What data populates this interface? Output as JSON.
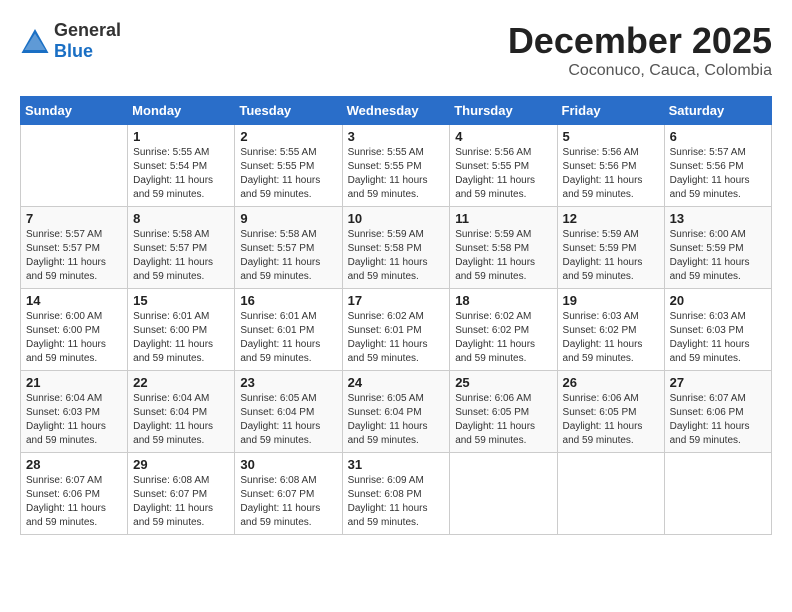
{
  "logo": {
    "general": "General",
    "blue": "Blue"
  },
  "title": "December 2025",
  "location": "Coconuco, Cauca, Colombia",
  "weekdays": [
    "Sunday",
    "Monday",
    "Tuesday",
    "Wednesday",
    "Thursday",
    "Friday",
    "Saturday"
  ],
  "weeks": [
    [
      {
        "day": "",
        "info": ""
      },
      {
        "day": "1",
        "info": "Sunrise: 5:55 AM\nSunset: 5:54 PM\nDaylight: 11 hours\nand 59 minutes."
      },
      {
        "day": "2",
        "info": "Sunrise: 5:55 AM\nSunset: 5:55 PM\nDaylight: 11 hours\nand 59 minutes."
      },
      {
        "day": "3",
        "info": "Sunrise: 5:55 AM\nSunset: 5:55 PM\nDaylight: 11 hours\nand 59 minutes."
      },
      {
        "day": "4",
        "info": "Sunrise: 5:56 AM\nSunset: 5:55 PM\nDaylight: 11 hours\nand 59 minutes."
      },
      {
        "day": "5",
        "info": "Sunrise: 5:56 AM\nSunset: 5:56 PM\nDaylight: 11 hours\nand 59 minutes."
      },
      {
        "day": "6",
        "info": "Sunrise: 5:57 AM\nSunset: 5:56 PM\nDaylight: 11 hours\nand 59 minutes."
      }
    ],
    [
      {
        "day": "7",
        "info": "Sunrise: 5:57 AM\nSunset: 5:57 PM\nDaylight: 11 hours\nand 59 minutes."
      },
      {
        "day": "8",
        "info": "Sunrise: 5:58 AM\nSunset: 5:57 PM\nDaylight: 11 hours\nand 59 minutes."
      },
      {
        "day": "9",
        "info": "Sunrise: 5:58 AM\nSunset: 5:57 PM\nDaylight: 11 hours\nand 59 minutes."
      },
      {
        "day": "10",
        "info": "Sunrise: 5:59 AM\nSunset: 5:58 PM\nDaylight: 11 hours\nand 59 minutes."
      },
      {
        "day": "11",
        "info": "Sunrise: 5:59 AM\nSunset: 5:58 PM\nDaylight: 11 hours\nand 59 minutes."
      },
      {
        "day": "12",
        "info": "Sunrise: 5:59 AM\nSunset: 5:59 PM\nDaylight: 11 hours\nand 59 minutes."
      },
      {
        "day": "13",
        "info": "Sunrise: 6:00 AM\nSunset: 5:59 PM\nDaylight: 11 hours\nand 59 minutes."
      }
    ],
    [
      {
        "day": "14",
        "info": "Sunrise: 6:00 AM\nSunset: 6:00 PM\nDaylight: 11 hours\nand 59 minutes."
      },
      {
        "day": "15",
        "info": "Sunrise: 6:01 AM\nSunset: 6:00 PM\nDaylight: 11 hours\nand 59 minutes."
      },
      {
        "day": "16",
        "info": "Sunrise: 6:01 AM\nSunset: 6:01 PM\nDaylight: 11 hours\nand 59 minutes."
      },
      {
        "day": "17",
        "info": "Sunrise: 6:02 AM\nSunset: 6:01 PM\nDaylight: 11 hours\nand 59 minutes."
      },
      {
        "day": "18",
        "info": "Sunrise: 6:02 AM\nSunset: 6:02 PM\nDaylight: 11 hours\nand 59 minutes."
      },
      {
        "day": "19",
        "info": "Sunrise: 6:03 AM\nSunset: 6:02 PM\nDaylight: 11 hours\nand 59 minutes."
      },
      {
        "day": "20",
        "info": "Sunrise: 6:03 AM\nSunset: 6:03 PM\nDaylight: 11 hours\nand 59 minutes."
      }
    ],
    [
      {
        "day": "21",
        "info": "Sunrise: 6:04 AM\nSunset: 6:03 PM\nDaylight: 11 hours\nand 59 minutes."
      },
      {
        "day": "22",
        "info": "Sunrise: 6:04 AM\nSunset: 6:04 PM\nDaylight: 11 hours\nand 59 minutes."
      },
      {
        "day": "23",
        "info": "Sunrise: 6:05 AM\nSunset: 6:04 PM\nDaylight: 11 hours\nand 59 minutes."
      },
      {
        "day": "24",
        "info": "Sunrise: 6:05 AM\nSunset: 6:04 PM\nDaylight: 11 hours\nand 59 minutes."
      },
      {
        "day": "25",
        "info": "Sunrise: 6:06 AM\nSunset: 6:05 PM\nDaylight: 11 hours\nand 59 minutes."
      },
      {
        "day": "26",
        "info": "Sunrise: 6:06 AM\nSunset: 6:05 PM\nDaylight: 11 hours\nand 59 minutes."
      },
      {
        "day": "27",
        "info": "Sunrise: 6:07 AM\nSunset: 6:06 PM\nDaylight: 11 hours\nand 59 minutes."
      }
    ],
    [
      {
        "day": "28",
        "info": "Sunrise: 6:07 AM\nSunset: 6:06 PM\nDaylight: 11 hours\nand 59 minutes."
      },
      {
        "day": "29",
        "info": "Sunrise: 6:08 AM\nSunset: 6:07 PM\nDaylight: 11 hours\nand 59 minutes."
      },
      {
        "day": "30",
        "info": "Sunrise: 6:08 AM\nSunset: 6:07 PM\nDaylight: 11 hours\nand 59 minutes."
      },
      {
        "day": "31",
        "info": "Sunrise: 6:09 AM\nSunset: 6:08 PM\nDaylight: 11 hours\nand 59 minutes."
      },
      {
        "day": "",
        "info": ""
      },
      {
        "day": "",
        "info": ""
      },
      {
        "day": "",
        "info": ""
      }
    ]
  ]
}
